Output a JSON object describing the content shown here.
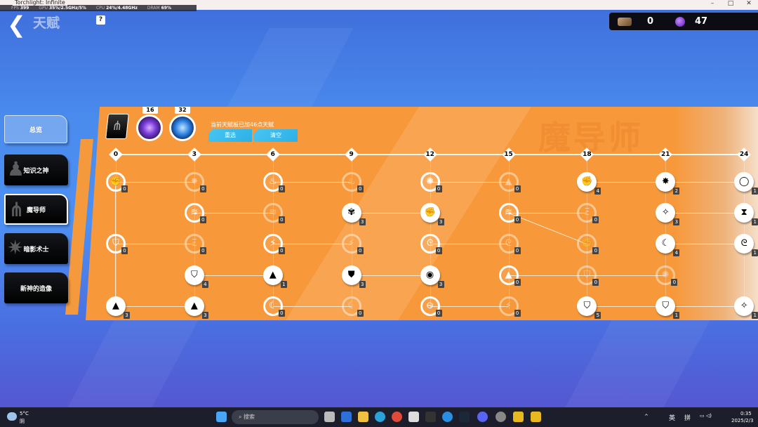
{
  "window": {
    "title": "Torchlight: Infinite",
    "minimize": "–",
    "maximize": "□",
    "close": "✕"
  },
  "perf": {
    "fps_label": "FPS",
    "fps": "399",
    "gpu_label": "GPU",
    "gpu": "35%/2.5GHz/5%",
    "cpu_label": "CPU",
    "cpu": "24%/4.48GHz",
    "dram_label": "DRAM",
    "dram": "69%"
  },
  "header": {
    "back": "❮",
    "title": "天赋",
    "help": "?"
  },
  "currency": {
    "items": [
      {
        "icon": "ore-icon",
        "value": "0"
      },
      {
        "icon": "purple-crystal-icon",
        "value": "47"
      }
    ]
  },
  "sidebar": {
    "items": [
      {
        "label": "总览",
        "state": "overview"
      },
      {
        "label": "知识之神",
        "state": "normal"
      },
      {
        "label": "魔导师",
        "state": "active"
      },
      {
        "label": "暗影术士",
        "state": "normal"
      },
      {
        "label": "新神的造像",
        "state": "normal"
      }
    ]
  },
  "panel": {
    "watermark": "魔导师",
    "orbs": [
      {
        "value": "16"
      },
      {
        "value": "32"
      }
    ],
    "summary": "当前天赋板已加46点天赋",
    "reselect": "重选",
    "clear": "清空",
    "ticks": [
      "0",
      "3",
      "6",
      "9",
      "12",
      "15",
      "18",
      "21",
      "24"
    ],
    "nodes": [
      {
        "id": "r0c0",
        "row": 0,
        "col": 0,
        "count": "0",
        "state": "outline",
        "glyph": "✊"
      },
      {
        "id": "r0c1",
        "row": 0,
        "col": 1,
        "count": "0",
        "state": "faded",
        "glyph": "✸"
      },
      {
        "id": "r0c2",
        "row": 0,
        "col": 2,
        "count": "0",
        "state": "outline",
        "glyph": "♨"
      },
      {
        "id": "r0c3",
        "row": 0,
        "col": 3,
        "count": "0",
        "state": "faded",
        "glyph": "♨"
      },
      {
        "id": "r0c4",
        "row": 0,
        "col": 4,
        "count": "0",
        "state": "outline",
        "glyph": "✺"
      },
      {
        "id": "r0c5",
        "row": 0,
        "col": 5,
        "count": "0",
        "state": "faded",
        "glyph": "▲"
      },
      {
        "id": "r0c6",
        "row": 0,
        "col": 6,
        "count": "4",
        "state": "active",
        "glyph": "✊"
      },
      {
        "id": "r0c7",
        "row": 0,
        "col": 7,
        "count": "2",
        "state": "active",
        "glyph": "✸"
      },
      {
        "id": "r0c8",
        "row": 0,
        "col": 8,
        "count": "1",
        "state": "active",
        "glyph": "◯"
      },
      {
        "id": "r1c1",
        "row": 1,
        "col": 1,
        "count": "0",
        "state": "outline",
        "glyph": "≋"
      },
      {
        "id": "r1c2",
        "row": 1,
        "col": 2,
        "count": "0",
        "state": "faded",
        "glyph": "≋"
      },
      {
        "id": "r1c3",
        "row": 1,
        "col": 3,
        "count": "3",
        "state": "active",
        "glyph": "✾"
      },
      {
        "id": "r1c4",
        "row": 1,
        "col": 4,
        "count": "3",
        "state": "active",
        "glyph": "✊"
      },
      {
        "id": "r1c5",
        "row": 1,
        "col": 5,
        "count": "0",
        "state": "outline",
        "glyph": "≋"
      },
      {
        "id": "r1c6",
        "row": 1,
        "col": 6,
        "count": "0",
        "state": "faded",
        "glyph": "Ξ"
      },
      {
        "id": "r1c7",
        "row": 1,
        "col": 7,
        "count": "3",
        "state": "active",
        "glyph": "✧"
      },
      {
        "id": "r1c8",
        "row": 1,
        "col": 8,
        "count": "1",
        "state": "active",
        "glyph": "⧗"
      },
      {
        "id": "r2c0",
        "row": 2,
        "col": 0,
        "count": "0",
        "state": "outline",
        "glyph": "⛉"
      },
      {
        "id": "r2c1",
        "row": 2,
        "col": 1,
        "count": "0",
        "state": "faded",
        "glyph": "Ξ"
      },
      {
        "id": "r2c2",
        "row": 2,
        "col": 2,
        "count": "0",
        "state": "outline",
        "glyph": "⚡"
      },
      {
        "id": "r2c3",
        "row": 2,
        "col": 3,
        "count": "0",
        "state": "faded",
        "glyph": "⚡"
      },
      {
        "id": "r2c4",
        "row": 2,
        "col": 4,
        "count": "0",
        "state": "outline",
        "glyph": "ᘓ"
      },
      {
        "id": "r2c5",
        "row": 2,
        "col": 5,
        "count": "0",
        "state": "faded",
        "glyph": "ᘓ"
      },
      {
        "id": "r2c6",
        "row": 2,
        "col": 6,
        "count": "0",
        "state": "faded",
        "glyph": "✊"
      },
      {
        "id": "r2c7",
        "row": 2,
        "col": 7,
        "count": "4",
        "state": "active",
        "glyph": "☾"
      },
      {
        "id": "r2c8",
        "row": 2,
        "col": 8,
        "count": "1",
        "state": "active",
        "glyph": "ᘓ"
      },
      {
        "id": "r3c1",
        "row": 3,
        "col": 1,
        "count": "4",
        "state": "active",
        "glyph": "⛉"
      },
      {
        "id": "r3c2",
        "row": 3,
        "col": 2,
        "count": "1",
        "state": "active",
        "glyph": "▲"
      },
      {
        "id": "r3c3",
        "row": 3,
        "col": 3,
        "count": "3",
        "state": "active",
        "glyph": "⛊"
      },
      {
        "id": "r3c4",
        "row": 3,
        "col": 4,
        "count": "3",
        "state": "active",
        "glyph": "◉"
      },
      {
        "id": "r3c5",
        "row": 3,
        "col": 5,
        "count": "0",
        "state": "outline",
        "glyph": "▲"
      },
      {
        "id": "r3c6",
        "row": 3,
        "col": 6,
        "count": "0",
        "state": "faded",
        "glyph": "⛉"
      },
      {
        "id": "r3c7",
        "row": 3,
        "col": 7,
        "count": "0",
        "state": "faded",
        "glyph": "✺"
      },
      {
        "id": "r4c0",
        "row": 4,
        "col": 0,
        "count": "3",
        "state": "active",
        "glyph": "▲"
      },
      {
        "id": "r4c1",
        "row": 4,
        "col": 1,
        "count": "3",
        "state": "active",
        "glyph": "▲"
      },
      {
        "id": "r4c2",
        "row": 4,
        "col": 2,
        "count": "0",
        "state": "outline",
        "glyph": "☾"
      },
      {
        "id": "r4c3",
        "row": 4,
        "col": 3,
        "count": "0",
        "state": "faded",
        "glyph": "☾"
      },
      {
        "id": "r4c4",
        "row": 4,
        "col": 4,
        "count": "0",
        "state": "outline",
        "glyph": "⊖"
      },
      {
        "id": "r4c5",
        "row": 4,
        "col": 5,
        "count": "0",
        "state": "faded",
        "glyph": "⚡"
      },
      {
        "id": "r4c6",
        "row": 4,
        "col": 6,
        "count": "5",
        "state": "active",
        "glyph": "⛉"
      },
      {
        "id": "r4c7",
        "row": 4,
        "col": 7,
        "count": "1",
        "state": "active",
        "glyph": "⛉"
      },
      {
        "id": "r4c8",
        "row": 4,
        "col": 8,
        "count": "1",
        "state": "active",
        "glyph": "✧"
      }
    ],
    "connections": [
      [
        "r0c0",
        "r0c1"
      ],
      [
        "r0c2",
        "r0c3"
      ],
      [
        "r0c4",
        "r0c5"
      ],
      [
        "r0c6",
        "r0c7"
      ],
      [
        "r0c7",
        "r0c8"
      ],
      [
        "r1c1",
        "r1c2"
      ],
      [
        "r1c3",
        "r1c4"
      ],
      [
        "r1c5",
        "r1c6"
      ],
      [
        "r1c7",
        "r1c8"
      ],
      [
        "r1c5",
        "r2c6"
      ],
      [
        "r2c0",
        "r2c1"
      ],
      [
        "r2c2",
        "r2c3"
      ],
      [
        "r2c4",
        "r2c5"
      ],
      [
        "r2c7",
        "r2c8"
      ],
      [
        "r3c1",
        "r3c2"
      ],
      [
        "r3c3",
        "r3c4"
      ],
      [
        "r3c5",
        "r3c6"
      ],
      [
        "r3c6",
        "r3c7"
      ],
      [
        "r4c0",
        "r4c1"
      ],
      [
        "r4c2",
        "r4c3"
      ],
      [
        "r4c4",
        "r4c5"
      ],
      [
        "r4c6",
        "r4c7"
      ],
      [
        "r4c7",
        "r4c8"
      ],
      [
        "r0c0",
        "r4c0"
      ]
    ]
  },
  "taskbar": {
    "weather_temp": "5°C",
    "weather_desc": "阴",
    "search": "搜索",
    "ime1": "英",
    "ime2": "拼",
    "time": "0:35",
    "date": "2025/2/3"
  }
}
